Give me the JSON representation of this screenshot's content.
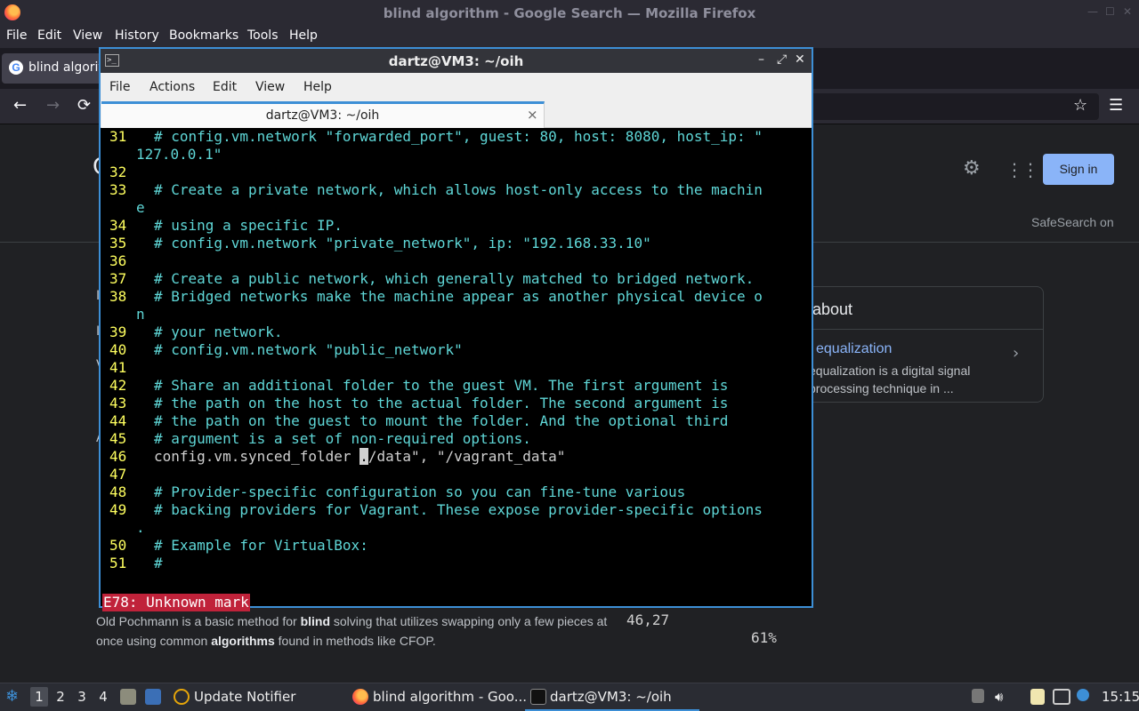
{
  "firefox": {
    "window_title": "blind algorithm - Google Search — Mozilla Firefox",
    "menu": [
      "File",
      "Edit",
      "View",
      "History",
      "Bookmarks",
      "Tools",
      "Help"
    ],
    "tab_label": "blind algorit",
    "icons": {
      "back": "←",
      "forward": "→",
      "reload": "⟳",
      "star": "☆",
      "menu": "☰",
      "minimize": "—",
      "maximize": "☐",
      "close": "✕"
    }
  },
  "google": {
    "logo_fragment": "G",
    "sign_in": "Sign in",
    "safesearch": "SafeSearch on",
    "card": {
      "about": "about",
      "link": "equalization",
      "snippet": "equalization is a digital signal processing technique in ..."
    },
    "left_fragments": [
      "I",
      "I",
      "V",
      "A"
    ],
    "snippet_parts": {
      "p1": "Old Pochmann is a basic method for ",
      "b1": "blind",
      "p2": " solving that utilizes swapping only a few pieces at once using common ",
      "b2": "algorithms",
      "p3": " found in methods like CFOP."
    },
    "icons": {
      "settings": "⚙",
      "apps": "⁙⁙⁙",
      "chevron": "›"
    }
  },
  "terminal": {
    "window_title": "dartz@VM3: ~/oih",
    "menu": [
      "File",
      "Actions",
      "Edit",
      "View",
      "Help"
    ],
    "tab_label": "dartz@VM3: ~/oih",
    "tab_close": "⨯",
    "controls": {
      "minimize": "–",
      "maximize": "⤢",
      "close": "✕"
    },
    "vim_lines": [
      {
        "n": "31",
        "t": "# config.vm.network \"forwarded_port\", guest: 80, host: 8080, host_ip: \"",
        "wrap": "127.0.0.1\""
      },
      {
        "n": "32",
        "t": ""
      },
      {
        "n": "33",
        "t": "# Create a private network, which allows host-only access to the machin",
        "wrap": "e"
      },
      {
        "n": "34",
        "t": "# using a specific IP."
      },
      {
        "n": "35",
        "t": "# config.vm.network \"private_network\", ip: \"192.168.33.10\""
      },
      {
        "n": "36",
        "t": ""
      },
      {
        "n": "37",
        "t": "# Create a public network, which generally matched to bridged network."
      },
      {
        "n": "38",
        "t": "# Bridged networks make the machine appear as another physical device o",
        "wrap": "n"
      },
      {
        "n": "39",
        "t": "# your network."
      },
      {
        "n": "40",
        "t": "# config.vm.network \"public_network\""
      },
      {
        "n": "41",
        "t": ""
      },
      {
        "n": "42",
        "t": "# Share an additional folder to the guest VM. The first argument is"
      },
      {
        "n": "43",
        "t": "# the path on the host to the actual folder. The second argument is"
      },
      {
        "n": "44",
        "t": "# the path on the guest to mount the folder. And the optional third"
      },
      {
        "n": "45",
        "t": "# argument is a set of non-required options."
      },
      {
        "n": "46",
        "pre": "config.vm.synced_folder ",
        "cur": ".",
        "post": "/data\", \"/vagrant_data\""
      },
      {
        "n": "47",
        "t": ""
      },
      {
        "n": "48",
        "t": "# Provider-specific configuration so you can fine-tune various"
      },
      {
        "n": "49",
        "t": "# backing providers for Vagrant. These expose provider-specific options",
        "wrap": "."
      },
      {
        "n": "50",
        "t": "# Example for VirtualBox:"
      },
      {
        "n": "51",
        "t": "#"
      }
    ],
    "status": {
      "error": "E78: Unknown mark",
      "position": "46,27",
      "percent": "61%"
    },
    "colors": {
      "line_number": "#ffff5f",
      "comment": "#5fd7d7",
      "error_bg": "#c0223a",
      "focus_border": "#3d8fd6"
    }
  },
  "taskbar": {
    "workspaces": [
      "1",
      "2",
      "3",
      "4"
    ],
    "active_workspace": "1",
    "tasks": [
      "Update Notifier",
      "blind algorithm - Goo...",
      "dartz@VM3: ~/oih"
    ],
    "clock": "15:15"
  }
}
